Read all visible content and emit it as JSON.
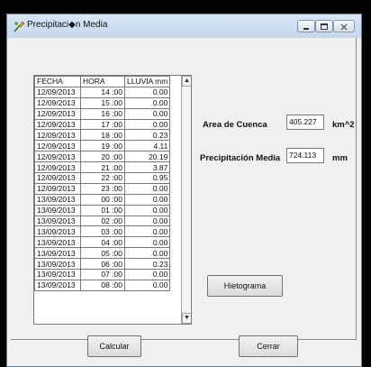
{
  "window": {
    "title": "Precipitaci◆n Media"
  },
  "grid": {
    "columns": [
      "FECHA",
      "HORA",
      "LLUVIA mm"
    ],
    "rows": [
      [
        "12/09/2013",
        "14 :00",
        "0.00"
      ],
      [
        "12/09/2013",
        "15 :00",
        "0.00"
      ],
      [
        "12/09/2013",
        "16 :00",
        "0.00"
      ],
      [
        "12/09/2013",
        "17 :00",
        "0.00"
      ],
      [
        "12/09/2013",
        "18 :00",
        "0.23"
      ],
      [
        "12/09/2013",
        "19 :00",
        "4.11"
      ],
      [
        "12/09/2013",
        "20 :00",
        "20.19"
      ],
      [
        "12/09/2013",
        "21 :00",
        "3.87"
      ],
      [
        "12/09/2013",
        "22 :00",
        "0.95"
      ],
      [
        "12/09/2013",
        "23 :00",
        "0.00"
      ],
      [
        "13/09/2013",
        "00 :00",
        "0.00"
      ],
      [
        "13/09/2013",
        "01 :00",
        "0.00"
      ],
      [
        "13/09/2013",
        "02 :00",
        "0.00"
      ],
      [
        "13/09/2013",
        "03 :00",
        "0.00"
      ],
      [
        "13/09/2013",
        "04 :00",
        "0.00"
      ],
      [
        "13/09/2013",
        "05 :00",
        "0.00"
      ],
      [
        "13/09/2013",
        "06 :00",
        "0.23"
      ],
      [
        "13/09/2013",
        "07 :00",
        "0.00"
      ],
      [
        "13/09/2013",
        "08 :00",
        "0.00"
      ]
    ]
  },
  "cuenca": {
    "label": "Area de Cuenca",
    "value": "405.227",
    "unit": "km^2"
  },
  "precip": {
    "label": "Precipitación Media",
    "value": "724.113",
    "unit": "mm"
  },
  "buttons": {
    "histograma": "Hietograma",
    "calcular": "Calcular",
    "cerrar": "Cerrar"
  }
}
